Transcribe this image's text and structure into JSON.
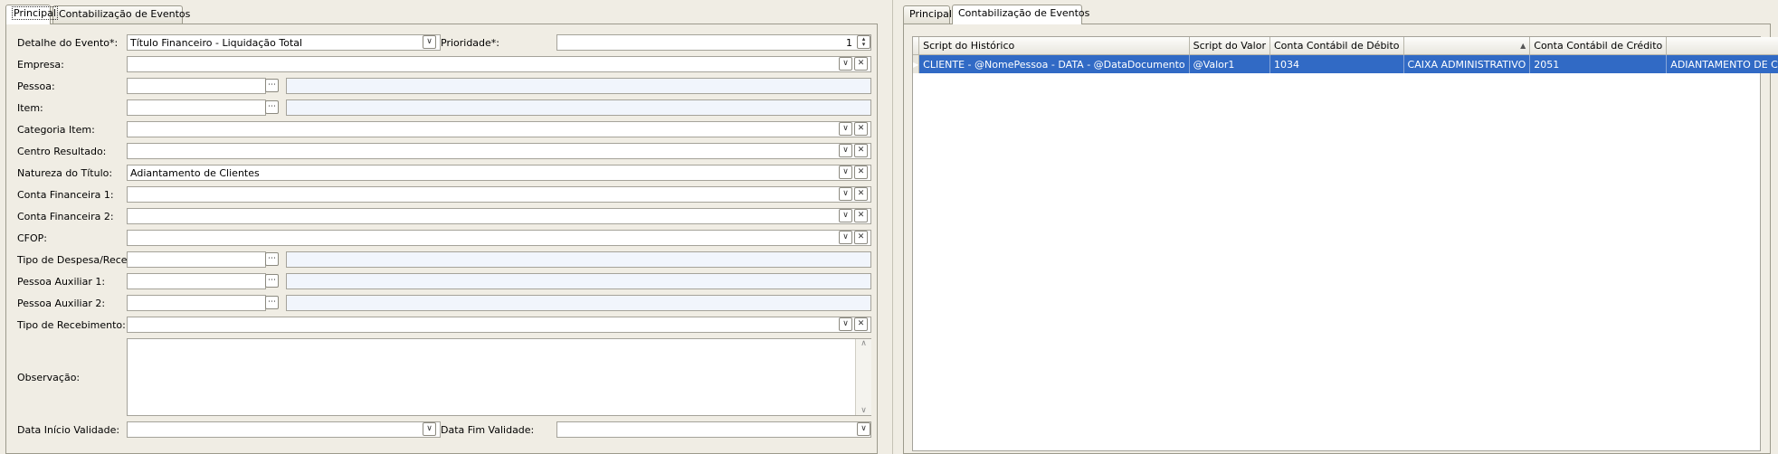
{
  "left_tabs": [
    "Principal",
    "Contabilização de Eventos"
  ],
  "right_tabs": [
    "Principal",
    "Contabilização de Eventos"
  ],
  "form": {
    "detalhe_label": "Detalhe do Evento*:",
    "detalhe_value": "Título Financeiro - Liquidação Total",
    "prioridade_label": "Prioridade*:",
    "prioridade_value": "1",
    "empresa_label": "Empresa:",
    "pessoa_label": "Pessoa:",
    "item_label": "Item:",
    "categoria_label": "Categoria Item:",
    "centro_label": "Centro Resultado:",
    "natureza_label": "Natureza do Título:",
    "natureza_value": "Adiantamento de Clientes",
    "conta_fin1_label": "Conta Financeira 1:",
    "conta_fin2_label": "Conta Financeira 2:",
    "cfop_label": "CFOP:",
    "tipo_despesa_label": "Tipo de Despesa/Receita:",
    "pessoa_aux1_label": "Pessoa Auxiliar 1:",
    "pessoa_aux2_label": "Pessoa Auxiliar 2:",
    "tipo_recebimento_label": "Tipo de Recebimento:",
    "observacao_label": "Observação:",
    "data_inicio_label": "Data Início Validade:",
    "data_fim_label": "Data Fim Validade:"
  },
  "grid": {
    "headers": [
      "Script do Histórico",
      "Script do Valor",
      "Conta Contábil de Débito",
      "",
      "Conta Contábil de Crédito",
      ""
    ],
    "rows": [
      [
        "CLIENTE - @NomePessoa - DATA - @DataDocumento",
        "@Valor1",
        "1034",
        "CAIXA ADMINISTRATIVO",
        "2051",
        "ADIANTAMENTO DE CLIENTES"
      ]
    ]
  }
}
